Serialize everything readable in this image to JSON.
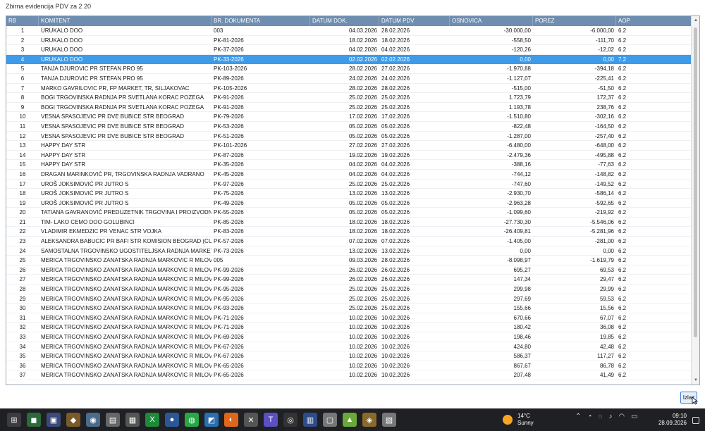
{
  "window": {
    "title": "Zbirna evidencija PDV za 2 20"
  },
  "columns": [
    "RB",
    "KOMITENT",
    "BR. DOKUMENTA",
    "DATUM DOK.",
    "DATUM PDV",
    "OSNOVICA",
    "POREZ",
    "AOP"
  ],
  "rows": [
    [
      "1",
      "URUKALO DOO",
      "003",
      "04.03.2026",
      "28.02.2026",
      "-30.000,00",
      "-6.000,00",
      "6.2"
    ],
    [
      "2",
      "URUKALO DOO",
      "PK-81-2026",
      "18.02.2026",
      "18.02.2026",
      "-558,50",
      "-111,70",
      "6.2"
    ],
    [
      "3",
      "URUKALO DOO",
      "PK-37-2026",
      "04.02.2026",
      "04.02.2026",
      "-120,26",
      "-12,02",
      "6.2"
    ],
    [
      "4",
      "URUKALO DOO",
      "PK-33-2026",
      "02.02.2026",
      "02.02.2026",
      "0,00",
      "0,00",
      "7.2"
    ],
    [
      "5",
      "TANJA DJUROVIC PR STEFAN PRO 95",
      "PK-103-2026",
      "28.02.2026",
      "27.02.2026",
      "-1.970,88",
      "-394,18",
      "6.2"
    ],
    [
      "6",
      "TANJA DJUROVIC PR STEFAN PRO 95",
      "PK-89-2026",
      "24.02.2026",
      "24.02.2026",
      "-1.127,07",
      "-225,41",
      "6.2"
    ],
    [
      "7",
      "MARKO GAVRILOVIC PR, FP MARKET, TR, SILJAKOVAC",
      "PK-105-2026",
      "28.02.2026",
      "28.02.2026",
      "-515,00",
      "-51,50",
      "6.2"
    ],
    [
      "8",
      "BOGI TRGOVINSKA RADNJA PR SVETLANA KORAC POZEGA",
      "PK-91-2026",
      "25.02.2026",
      "25.02.2026",
      "1.723,79",
      "172,37",
      "6.2"
    ],
    [
      "9",
      "BOGI TRGOVINSKA RADNJA PR SVETLANA KORAC POZEGA",
      "PK-91-2026",
      "25.02.2026",
      "25.02.2026",
      "1.193,78",
      "238,76",
      "6.2"
    ],
    [
      "10",
      "VESNA SPASOJEVIC PR DVE BUBICE STR BEOGRAD",
      "PK-79-2026",
      "17.02.2026",
      "17.02.2026",
      "-1.510,80",
      "-302,16",
      "6.2"
    ],
    [
      "11",
      "VESNA SPASOJEVIC PR DVE BUBICE STR BEOGRAD",
      "PK-53-2026",
      "05.02.2026",
      "05.02.2026",
      "-822,48",
      "-164,50",
      "6.2"
    ],
    [
      "12",
      "VESNA SPASOJEVIC PR DVE BUBICE STR BEOGRAD",
      "PK-51-2026",
      "05.02.2026",
      "05.02.2026",
      "-1.287,00",
      "-257,40",
      "6.2"
    ],
    [
      "13",
      "HAPPY DAY STR",
      "PK-101-2026",
      "27.02.2026",
      "27.02.2026",
      "-6.480,00",
      "-648,00",
      "6.2"
    ],
    [
      "14",
      "HAPPY DAY STR",
      "PK-87-2026",
      "19.02.2026",
      "19.02.2026",
      "-2.479,36",
      "-495,88",
      "6.2"
    ],
    [
      "15",
      "HAPPY DAY STR",
      "PK-35-2026",
      "04.02.2026",
      "04.02.2026",
      "-388,16",
      "-77,63",
      "6.2"
    ],
    [
      "16",
      "DRAGAN MARINKOVIĆ PR, TRGOVINSKA RADNJA VADRANO",
      "PK-45-2026",
      "04.02.2026",
      "04.02.2026",
      "-744,12",
      "-148,82",
      "6.2"
    ],
    [
      "17",
      "UROŠ JOKSIMOVIĆ PR JUTRO S",
      "PK-97-2026",
      "25.02.2026",
      "25.02.2026",
      "-747,60",
      "-149,52",
      "6.2"
    ],
    [
      "18",
      "UROŠ JOKSIMOVIĆ PR JUTRO S",
      "PK-75-2026",
      "13.02.2026",
      "13.02.2026",
      "-2.930,70",
      "-586,14",
      "6.2"
    ],
    [
      "19",
      "UROŠ JOKSIMOVIĆ PR JUTRO S",
      "PK-49-2026",
      "05.02.2026",
      "05.02.2026",
      "-2.963,28",
      "-592,65",
      "6.2"
    ],
    [
      "20",
      "TATIANA GAVRANOVIĆ PREDUZETNIK TRGOVINA I PROIZVODNJA K...",
      "PK-55-2026",
      "05.02.2026",
      "05.02.2026",
      "-1.099,60",
      "-219,92",
      "6.2"
    ],
    [
      "21",
      "TIM- LAKO CEMO DOO GOLUBINCI",
      "PK-85-2026",
      "18.02.2026",
      "18.02.2026",
      "-27.730,30",
      "-5.546,06",
      "6.2"
    ],
    [
      "22",
      "VLADIMIR EKMEDZIC PR VENAC STR VOJKA",
      "PK-83-2026",
      "18.02.2026",
      "18.02.2026",
      "-26.409,81",
      "-5.281,96",
      "6.2"
    ],
    [
      "23",
      "ALEKSANDRA BABUCIC PR BAFI STR  KOMISION BEOGRAD (CUKARI...",
      "PK-57-2026",
      "07.02.2026",
      "07.02.2026",
      "-1.405,00",
      "-281,00",
      "6.2"
    ],
    [
      "24",
      "SAMOSTALNA TRGOVINSKO UGOSTITELJSKA RADNJA MARKET AS ...",
      "PK-73-2026",
      "13.02.2026",
      "13.02.2026",
      "0,00",
      "0,00",
      "6.2"
    ],
    [
      "25",
      "MERICA TRGOVINSKO ZANATSKA  RADNJA MARKOVIC R MILOVAN ...",
      "005",
      "09.03.2026",
      "28.02.2026",
      "-8.098,97",
      "-1.619,79",
      "6.2"
    ],
    [
      "26",
      "MERICA TRGOVINSKO ZANATSKA  RADNJA MARKOVIC R MILOVAN ...",
      "PK-99-2026",
      "26.02.2026",
      "26.02.2026",
      "695,27",
      "69,53",
      "6.2"
    ],
    [
      "27",
      "MERICA TRGOVINSKO ZANATSKA  RADNJA MARKOVIC R MILOVAN ...",
      "PK-99-2026",
      "26.02.2026",
      "26.02.2026",
      "147,34",
      "29,47",
      "6.2"
    ],
    [
      "28",
      "MERICA TRGOVINSKO ZANATSKA  RADNJA MARKOVIC R MILOVAN ...",
      "PK-95-2026",
      "25.02.2026",
      "25.02.2026",
      "299,98",
      "29,99",
      "6.2"
    ],
    [
      "29",
      "MERICA TRGOVINSKO ZANATSKA  RADNJA MARKOVIC R MILOVAN ...",
      "PK-95-2026",
      "25.02.2026",
      "25.02.2026",
      "297,69",
      "59,53",
      "6.2"
    ],
    [
      "30",
      "MERICA TRGOVINSKO ZANATSKA  RADNJA MARKOVIC R MILOVAN ...",
      "PK-93-2026",
      "25.02.2026",
      "25.02.2026",
      "155,66",
      "15,56",
      "6.2"
    ],
    [
      "31",
      "MERICA TRGOVINSKO ZANATSKA  RADNJA MARKOVIC R MILOVAN ...",
      "PK-71-2026",
      "10.02.2026",
      "10.02.2026",
      "670,66",
      "67,07",
      "6.2"
    ],
    [
      "32",
      "MERICA TRGOVINSKO ZANATSKA  RADNJA MARKOVIC R MILOVAN ...",
      "PK-71-2026",
      "10.02.2026",
      "10.02.2026",
      "180,42",
      "36,08",
      "6.2"
    ],
    [
      "33",
      "MERICA TRGOVINSKO ZANATSKA  RADNJA MARKOVIC R MILOVAN ...",
      "PK-69-2026",
      "10.02.2026",
      "10.02.2026",
      "198,46",
      "19,85",
      "6.2"
    ],
    [
      "34",
      "MERICA TRGOVINSKO ZANATSKA  RADNJA MARKOVIC R MILOVAN ...",
      "PK-67-2026",
      "10.02.2026",
      "10.02.2026",
      "424,80",
      "42,48",
      "6.2"
    ],
    [
      "35",
      "MERICA TRGOVINSKO ZANATSKA  RADNJA MARKOVIC R MILOVAN ...",
      "PK-67-2026",
      "10.02.2026",
      "10.02.2026",
      "586,37",
      "117,27",
      "6.2"
    ],
    [
      "36",
      "MERICA TRGOVINSKO ZANATSKA  RADNJA MARKOVIC R MILOVAN ...",
      "PK-65-2026",
      "10.02.2026",
      "10.02.2026",
      "867,67",
      "86,78",
      "6.2"
    ],
    [
      "37",
      "MERICA TRGOVINSKO ZANATSKA  RADNJA MARKOVIC R MILOVAN ...",
      "PK-65-2026",
      "10.02.2026",
      "10.02.2026",
      "207,48",
      "41,49",
      "6.2"
    ]
  ],
  "selected_row": 3,
  "buttons": {
    "close": "Izlaz"
  },
  "taskbar": {
    "weather_temp": "14°C",
    "weather_desc": "Sunny",
    "time": "09:10",
    "date": "28.09.2026"
  },
  "colors": {
    "header": "#6e8db0",
    "selection": "#3d9be9",
    "taskbar": "#1f2023"
  }
}
